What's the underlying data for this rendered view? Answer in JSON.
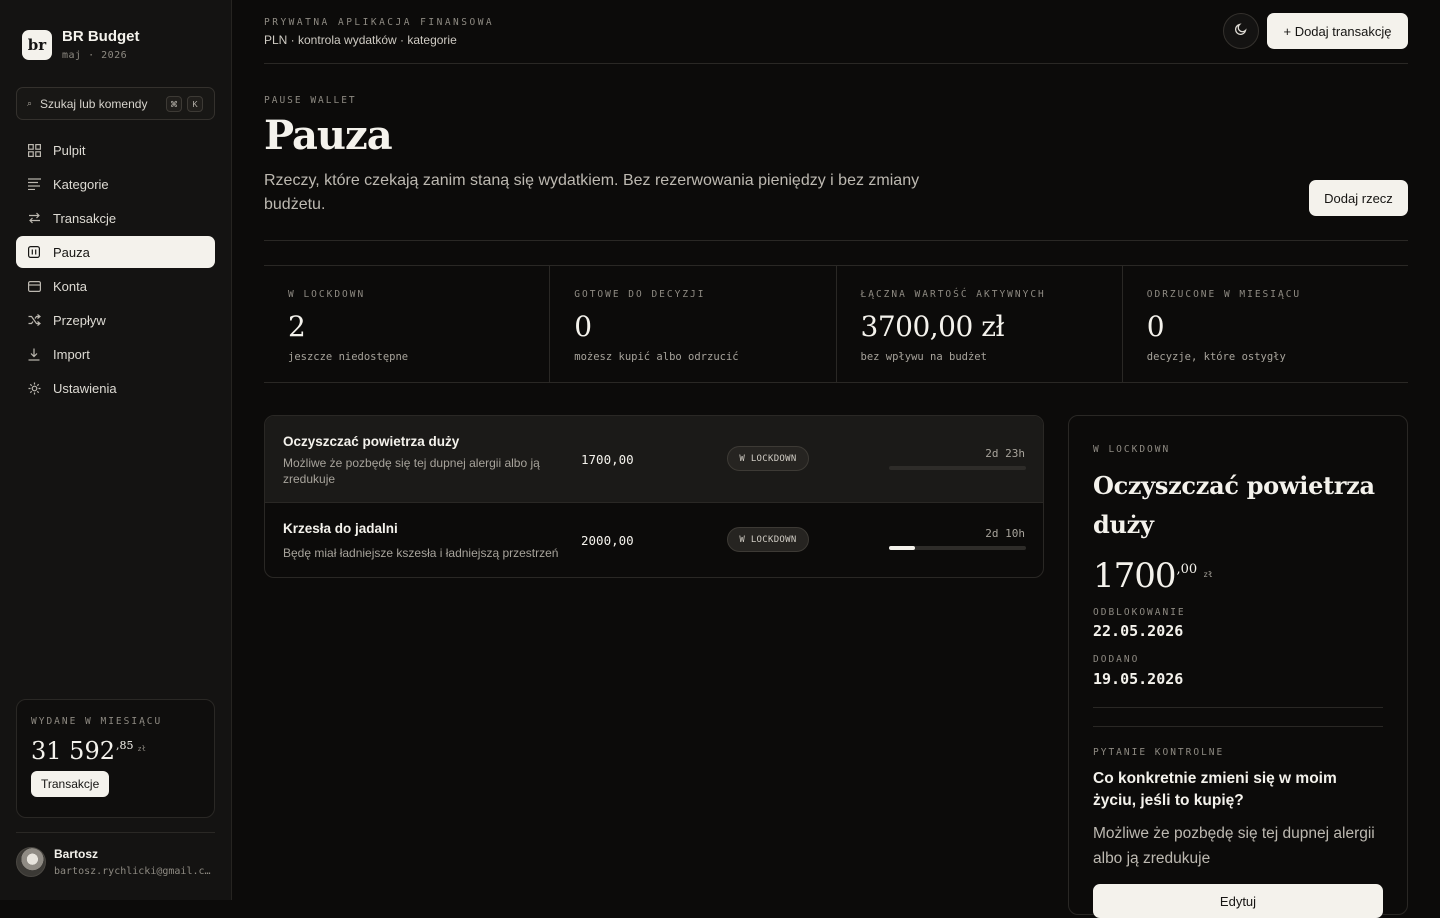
{
  "brand": {
    "logo": "br",
    "name": "BR Budget",
    "period": "maj · 2026"
  },
  "search": {
    "label": "Szukaj lub komendy",
    "kbd1": "⌘",
    "kbd2": "K"
  },
  "nav": [
    {
      "label": "Pulpit",
      "icon": "grid-icon"
    },
    {
      "label": "Kategorie",
      "icon": "list-icon"
    },
    {
      "label": "Transakcje",
      "icon": "arrows-icon"
    },
    {
      "label": "Pauza",
      "icon": "pause-icon",
      "active": true
    },
    {
      "label": "Konta",
      "icon": "card-icon"
    },
    {
      "label": "Przepływ",
      "icon": "shuffle-icon"
    },
    {
      "label": "Import",
      "icon": "download-icon"
    },
    {
      "label": "Ustawienia",
      "icon": "gear-icon"
    }
  ],
  "spent": {
    "label": "WYDANE W MIESIĄCU",
    "int": "31 592",
    "dec": ",85",
    "currency": "zł",
    "button": "Transakcje"
  },
  "user": {
    "name": "Bartosz",
    "email": "bartosz.rychlicki@gmail.com"
  },
  "topbar": {
    "caps": "PRYWATNA APLIKACJA FINANSOWA",
    "sub": "PLN · kontrola wydatków · kategorie",
    "add_tx": "+ Dodaj transakcję"
  },
  "page": {
    "eyebrow": "PAUSE WALLET",
    "title": "Pauza",
    "desc": "Rzeczy, które czekają zanim staną się wydatkiem. Bez rezerwowania pieniędzy i bez zmiany budżetu.",
    "add_item": "Dodaj rzecz"
  },
  "stats": [
    {
      "label": "W LOCKDOWN",
      "value": "2",
      "note": "jeszcze niedostępne"
    },
    {
      "label": "GOTOWE DO DECYZJI",
      "value": "0",
      "note": "możesz kupić albo odrzucić"
    },
    {
      "label": "ŁĄCZNA WARTOŚĆ AKTYWNYCH",
      "value": "3700,00 zł",
      "note": "bez wpływu na budżet"
    },
    {
      "label": "ODRZUCONE W MIESIĄCU",
      "value": "0",
      "note": "decyzje, które ostygły"
    }
  ],
  "items": [
    {
      "name": "Oczyszczać powietrza duży",
      "desc": "Możliwe że pozbędę się tej dupnej alergii albo ją zredukuje",
      "amount": "1700,00",
      "status": "W LOCKDOWN",
      "timer": "2d 23h",
      "progress": 0.0
    },
    {
      "name": "Krzesła do jadalni",
      "desc": "Będę miał ładniejsze kszesła i ładniejszą przestrzeń",
      "amount": "2000,00",
      "status": "W LOCKDOWN",
      "timer": "2d 10h",
      "progress": 0.19
    }
  ],
  "detail": {
    "status": "W LOCKDOWN",
    "title": "Oczyszczać powietrza duży",
    "amount_int": "1700",
    "amount_dec": ",00",
    "currency": "zł",
    "unlock_label": "ODBLOKOWANIE",
    "unlock_date": "22.05.2026",
    "added_label": "DODANO",
    "added_date": "19.05.2026",
    "question_label": "PYTANIE KONTROLNE",
    "question": "Co konkretnie zmieni się w moim życiu, jeśli to kupię?",
    "answer": "Możliwe że pozbędę się tej dupnej alergii albo ją zredukuje",
    "edit": "Edytuj"
  }
}
